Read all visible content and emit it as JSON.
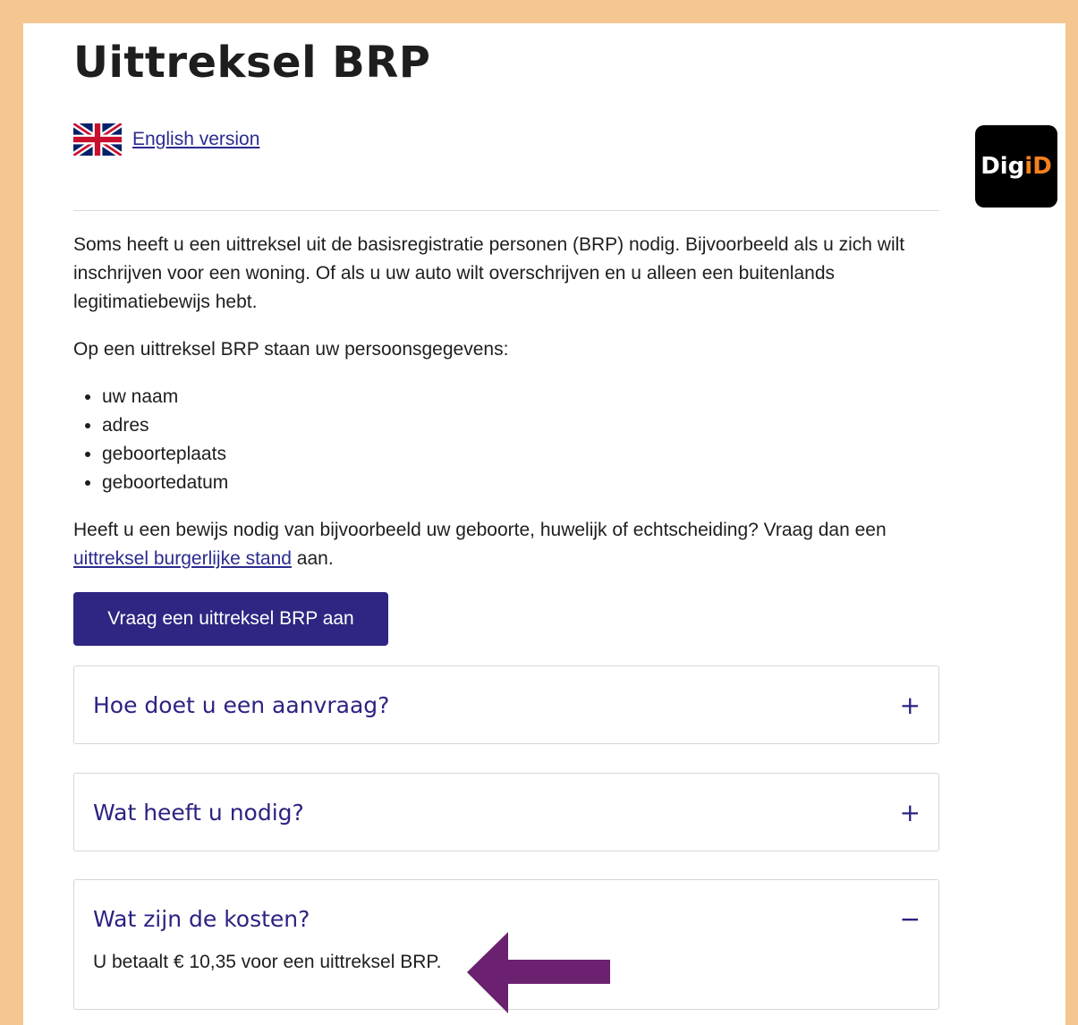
{
  "page": {
    "title": "Uittreksel BRP",
    "english_link": "English version",
    "intro": "Soms heeft u een uittreksel uit de basisregistratie personen (BRP) nodig. Bijvoorbeeld als u zich wilt inschrijven voor een woning. Of als u uw auto wilt overschrijven en u alleen een buitenlands legitimatiebewijs hebt.",
    "list_intro": "Op een uittreksel BRP staan uw persoonsgegevens:",
    "list_items": [
      "uw naam",
      "adres",
      "geboorteplaats",
      "geboortedatum"
    ],
    "p3_before": "Heeft u een bewijs nodig van bijvoorbeeld uw geboorte, huwelijk of echtscheiding? Vraag dan een ",
    "p3_link": "uittreksel burgerlijke stand",
    "p3_after": " aan.",
    "cta_label": "Vraag een uittreksel BRP aan"
  },
  "accordion": [
    {
      "title": "Hoe doet u een aanvraag?",
      "icon": "+",
      "expanded": false
    },
    {
      "title": "Wat heeft u nodig?",
      "icon": "+",
      "expanded": false
    },
    {
      "title": "Wat zijn de kosten?",
      "icon": "−",
      "expanded": true,
      "body": "U betaalt € 10,35 voor een uittreksel BRP."
    }
  ],
  "digid": {
    "part1": "Dig",
    "part2": "iD",
    "accent_color": "#f48120"
  },
  "colors": {
    "brand": "#2e2682",
    "frame": "#f4c690",
    "arrow": "#6b2170"
  },
  "icons": {
    "flag": "uk-flag-icon",
    "plus": "plus-icon",
    "minus": "minus-icon",
    "arrow": "arrow-left-icon"
  }
}
